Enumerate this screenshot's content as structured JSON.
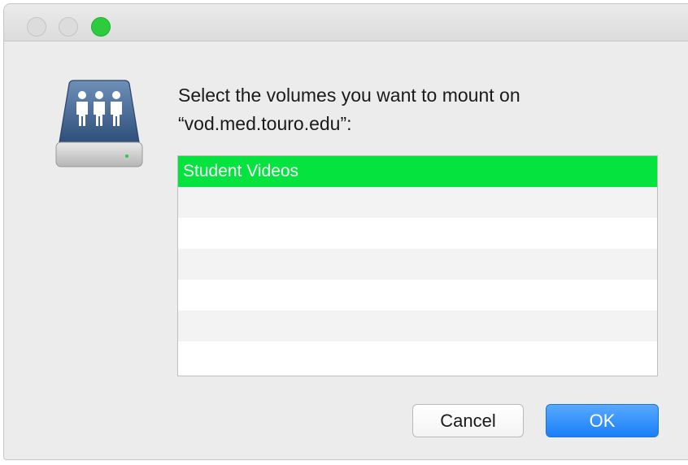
{
  "window": {
    "traffic_lights": [
      "close",
      "minimize",
      "zoom"
    ]
  },
  "dialog": {
    "icon": "shared-server-icon",
    "prompt_line1": "Select the volumes you want to mount on",
    "prompt_line2": "“vod.med.touro.edu”:"
  },
  "volumes": {
    "items": [
      {
        "label": "Student Videos",
        "selected": true
      },
      {
        "label": "",
        "selected": false
      },
      {
        "label": "",
        "selected": false
      },
      {
        "label": "",
        "selected": false
      },
      {
        "label": "",
        "selected": false
      },
      {
        "label": "",
        "selected": false
      },
      {
        "label": "",
        "selected": false
      }
    ],
    "selection_color": "#05e33f"
  },
  "buttons": {
    "cancel_label": "Cancel",
    "ok_label": "OK"
  }
}
